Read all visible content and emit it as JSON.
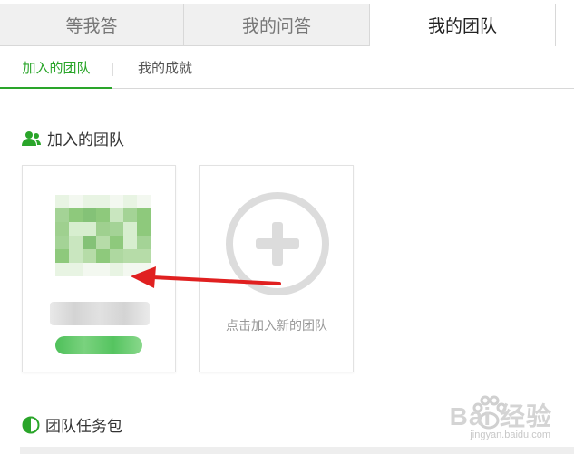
{
  "top_tabs": [
    {
      "label": "等我答",
      "active": false
    },
    {
      "label": "我的问答",
      "active": false
    },
    {
      "label": "我的团队",
      "active": true
    }
  ],
  "sub_tabs": [
    {
      "label": "加入的团队",
      "active": true
    },
    {
      "label": "我的成就",
      "active": false
    }
  ],
  "joined_section": {
    "title": "加入的团队",
    "icon": "users-icon"
  },
  "add_team_card": {
    "caption": "点击加入新的团队",
    "icon": "plus-circle-icon"
  },
  "task_section": {
    "title": "团队任务包",
    "icon": "pie-icon"
  },
  "annotation": {
    "arrow_color": "#e02020"
  },
  "watermark": {
    "main": "Bai 经验",
    "sub": "jingyan.baidu.com"
  },
  "colors": {
    "accent": "#2aa52a",
    "muted_text": "#999999"
  }
}
